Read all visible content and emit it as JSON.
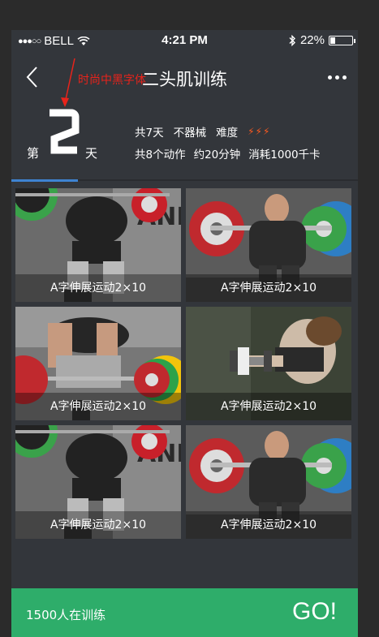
{
  "status_bar": {
    "carrier": "BELL",
    "time": "4:21 PM",
    "battery_percent": "22%",
    "battery_level": 0.22,
    "signal_dots": "●●●○○"
  },
  "nav": {
    "title": "二头肌训练",
    "back_icon": "chevron-left-icon",
    "more_icon": "more-dots-icon"
  },
  "annotation": {
    "text": "时尚中黑字体",
    "color": "#e8231b"
  },
  "day": {
    "prefix": "第",
    "number": "2",
    "suffix": "天"
  },
  "info": {
    "total_days": "共7天",
    "equipment": "不器械",
    "difficulty_label": "难度",
    "difficulty_icons": "⚡⚡⚡",
    "actions": "共8个动作",
    "duration": "约20分钟",
    "calories": "消耗1000千卡"
  },
  "tabs": {
    "active_color": "#3e83d2"
  },
  "exercises": [
    {
      "label": "A字伸展运动2×10"
    },
    {
      "label": "A字伸展运动2×10"
    },
    {
      "label": "A字伸展运动2×10"
    },
    {
      "label": "A字伸展运动2×10"
    },
    {
      "label": "A字伸展运动2×10"
    },
    {
      "label": "A字伸展运动2×10"
    }
  ],
  "footer": {
    "trainers": "1500人在训练",
    "go_label": "GO!",
    "color": "#2ead6a"
  }
}
